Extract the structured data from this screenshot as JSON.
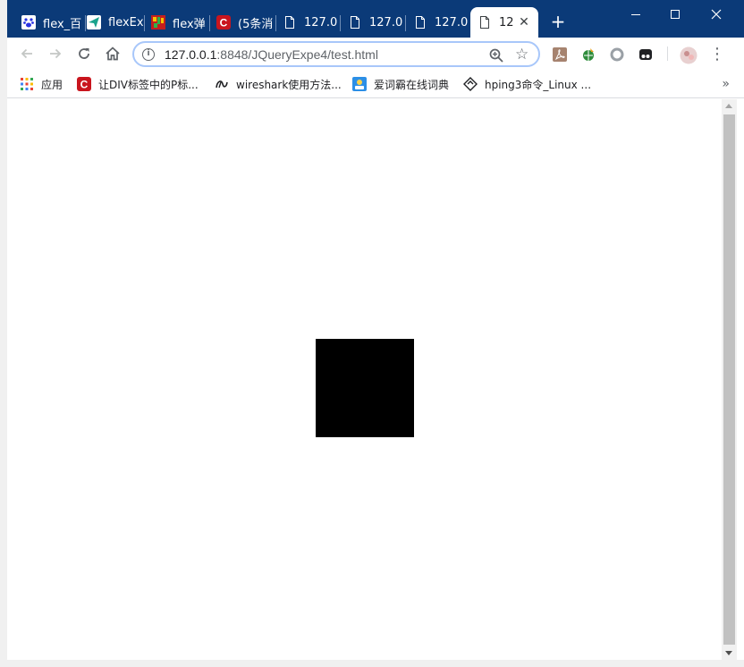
{
  "tabs": [
    {
      "label": "flex_百",
      "icon": "paw-icon",
      "active": false
    },
    {
      "label": "flexEx",
      "icon": "paper-plane-icon",
      "active": false
    },
    {
      "label": "flex弹",
      "icon": "colorful-grid-icon",
      "active": false
    },
    {
      "label": "(5条消",
      "icon": "csdn-c-icon",
      "active": false
    },
    {
      "label": "127.0",
      "icon": "page-icon",
      "active": false
    },
    {
      "label": "127.0",
      "icon": "page-icon",
      "active": false
    },
    {
      "label": "127.0",
      "icon": "page-icon",
      "active": false
    },
    {
      "label": "12",
      "icon": "page-icon",
      "active": true
    }
  ],
  "window_controls": {
    "minimize": "—",
    "maximize": "☐",
    "close": "✕"
  },
  "toolbar": {
    "back": "←",
    "forward": "→",
    "reload": "↻",
    "home": "⌂",
    "new_tab": "+",
    "menu": "⋮"
  },
  "omnibox": {
    "host": "127.0.0.1",
    "path": ":8848/JQueryExpe4/test.html",
    "info_glyph": "i",
    "star": "☆"
  },
  "bookmarks": [
    {
      "label": "应用",
      "icon": "apps-grid-icon"
    },
    {
      "label": "让DIV标签中的P标...",
      "icon": "csdn-c-icon"
    },
    {
      "label": "wireshark使用方法...",
      "icon": "swirl-logo-icon"
    },
    {
      "label": "爱词霸在线词典",
      "icon": "iciba-icon"
    },
    {
      "label": "hping3命令_Linux ...",
      "icon": "diamond-logo-icon"
    }
  ],
  "bookmarks_more": "»",
  "colors": {
    "tabstrip": "#0b3a78",
    "omnibox_border": "#a8c7fa",
    "box": "#000000"
  }
}
